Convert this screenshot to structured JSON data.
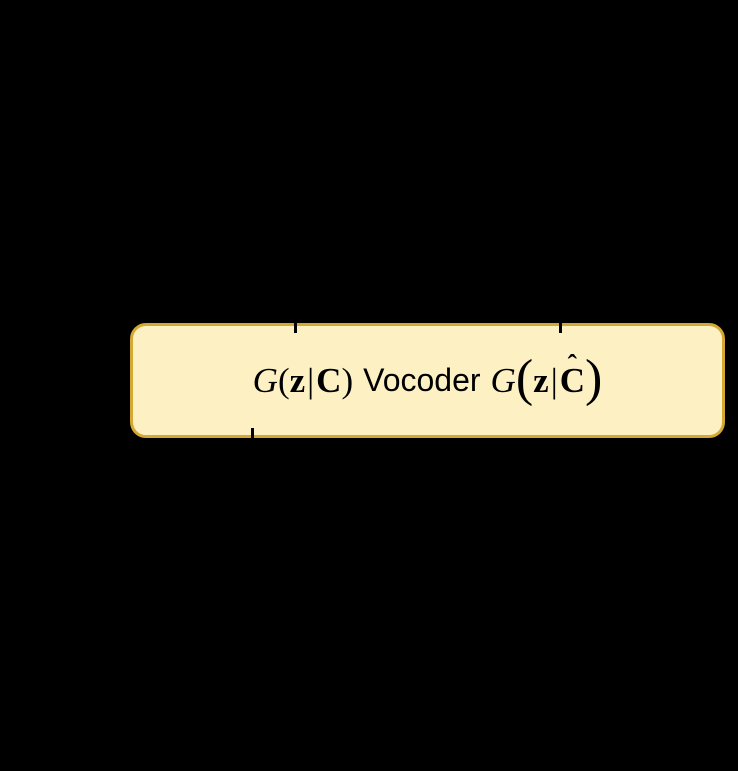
{
  "diagram": {
    "vocoder_label": "Vocoder",
    "left_formula": {
      "function": "G",
      "var1": "z",
      "var2": "C"
    },
    "right_formula": {
      "function": "G",
      "var1": "z",
      "var2_hat": "C"
    }
  }
}
